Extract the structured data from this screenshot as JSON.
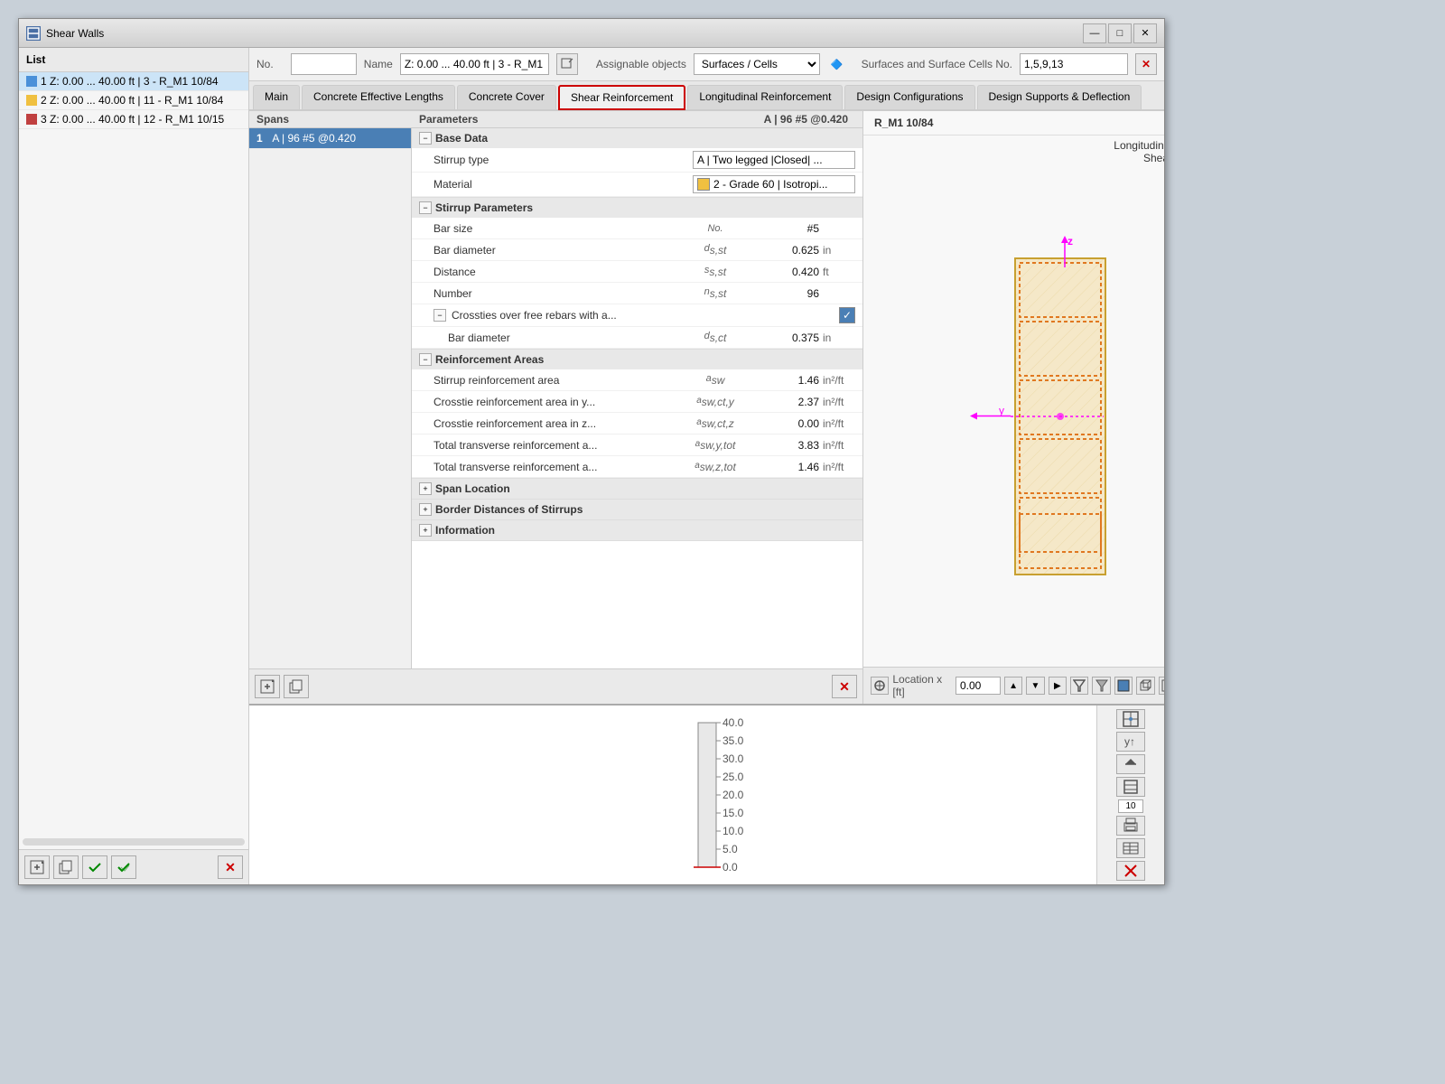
{
  "window": {
    "title": "Shear Walls",
    "icon": "SW"
  },
  "header": {
    "no_label": "No.",
    "name_label": "Name",
    "name_value": "Z: 0.00 ... 40.00 ft | 3 - R_M1 10/84",
    "assignable_label": "Assignable objects",
    "assign_select_value": "Surfaces / Cells",
    "surfaces_label": "Surfaces and Surface Cells No.",
    "surfaces_value": "1,5,9,13"
  },
  "tabs": [
    {
      "label": "Main",
      "active": false
    },
    {
      "label": "Concrete Effective Lengths",
      "active": false
    },
    {
      "label": "Concrete Cover",
      "active": false
    },
    {
      "label": "Shear Reinforcement",
      "active": true,
      "highlighted": true
    },
    {
      "label": "Longitudinal Reinforcement",
      "active": false
    },
    {
      "label": "Design Configurations",
      "active": false
    },
    {
      "label": "Design Supports & Deflection",
      "active": false
    }
  ],
  "sidebar": {
    "header": "List",
    "items": [
      {
        "text": "1 Z: 0.00 ... 40.00 ft | 3 - R_M1 10/84",
        "color": "#4a90d9",
        "selected": true
      },
      {
        "text": "2 Z: 0.00 ... 40.00 ft | 11 - R_M1 10/84",
        "color": "#f0c040",
        "selected": false
      },
      {
        "text": "3 Z: 0.00 ... 40.00 ft | 12 - R_M1 10/15",
        "color": "#c04040",
        "selected": false
      }
    ]
  },
  "spans": {
    "header": "Spans",
    "items": [
      {
        "no": 1,
        "label": "A | 96 #5 @0.420",
        "selected": true
      }
    ]
  },
  "params": {
    "header": "Parameters",
    "value_header": "A | 96 #5 @0.420",
    "sections": [
      {
        "label": "Base Data",
        "expanded": true,
        "rows": [
          {
            "name": "Stirrup type",
            "symbol": "",
            "value": "A | Two legged | Closed | ...",
            "unit": "",
            "type": "dropdown"
          },
          {
            "name": "Material",
            "symbol": "",
            "value": "2 - Grade 60 | Isotropi...",
            "unit": "",
            "type": "color_dropdown",
            "color": "#f0c040"
          }
        ]
      },
      {
        "label": "Stirrup Parameters",
        "expanded": true,
        "rows": [
          {
            "name": "Bar size",
            "symbol": "No.",
            "value": "#5",
            "unit": "",
            "type": "text"
          },
          {
            "name": "Bar diameter",
            "symbol": "ds,st",
            "value": "0.625",
            "unit": "in",
            "type": "text"
          },
          {
            "name": "Distance",
            "symbol": "ss,st",
            "value": "0.420",
            "unit": "ft",
            "type": "text"
          },
          {
            "name": "Number",
            "symbol": "ns,st",
            "value": "96",
            "unit": "",
            "type": "text"
          },
          {
            "name": "Crossties over free rebars with a...",
            "symbol": "",
            "value": "",
            "unit": "",
            "type": "checkbox_parent",
            "checked": true
          },
          {
            "name": "Bar diameter",
            "symbol": "ds,ct",
            "value": "0.375",
            "unit": "in",
            "type": "text",
            "sub": true
          }
        ]
      },
      {
        "label": "Reinforcement Areas",
        "expanded": true,
        "rows": [
          {
            "name": "Stirrup reinforcement area",
            "symbol": "asw",
            "value": "1.46",
            "unit": "in²/ft",
            "type": "text"
          },
          {
            "name": "Crosstie reinforcement area in y...",
            "symbol": "asw,ct,y",
            "value": "2.37",
            "unit": "in²/ft",
            "type": "text"
          },
          {
            "name": "Crosstie reinforcement area in z...",
            "symbol": "asw,ct,z",
            "value": "0.00",
            "unit": "in²/ft",
            "type": "text"
          },
          {
            "name": "Total transverse reinforcement a...",
            "symbol": "asw,y,tot",
            "value": "3.83",
            "unit": "in²/ft",
            "type": "text"
          },
          {
            "name": "Total transverse reinforcement a...",
            "symbol": "asw,z,tot",
            "value": "1.46",
            "unit": "in²/ft",
            "type": "text"
          }
        ]
      },
      {
        "label": "Span Location",
        "expanded": false,
        "rows": []
      },
      {
        "label": "Border Distances of Stirrups",
        "expanded": false,
        "rows": []
      },
      {
        "label": "Information",
        "expanded": false,
        "rows": []
      }
    ]
  },
  "viz": {
    "header": "R_M1 10/84",
    "label1": "Longitudinal Reinforcement",
    "label2": "Shear Reinforcement",
    "z_label": "z",
    "y_label": "y",
    "location_label": "Location x [ft]",
    "location_value": "0.00"
  },
  "stirrup_closed_label": "Closed",
  "bottom_toolbar": {
    "buttons": [
      "⊕",
      "◫",
      "⊞",
      "▶",
      "≡",
      "⊡",
      "⊞",
      "▦",
      "🖨",
      "▼"
    ]
  }
}
